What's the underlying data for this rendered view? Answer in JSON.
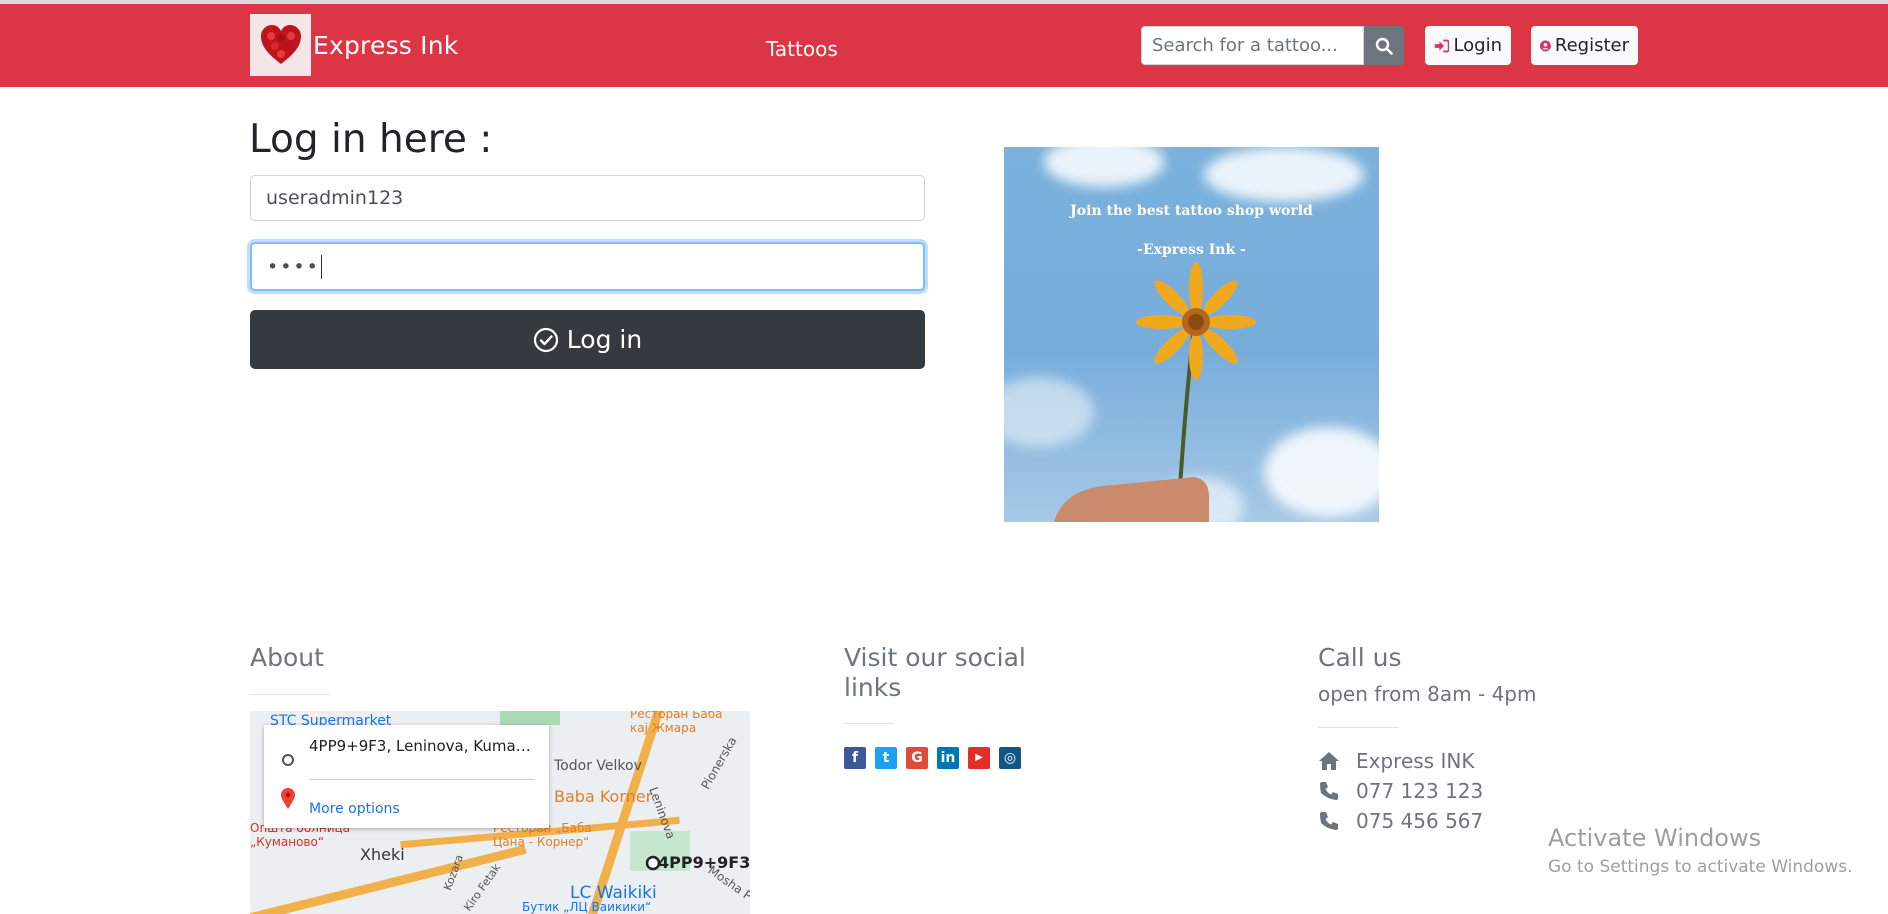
{
  "navbar": {
    "brand": "Express Ink",
    "links": [
      {
        "label": "Tattoos"
      }
    ],
    "search": {
      "placeholder": "Search for a tattoo..."
    },
    "login_label": "Login",
    "register_label": "Register",
    "color": "#dc3545"
  },
  "login_form": {
    "title": "Log in here :",
    "username_value": "useradmin123",
    "password_masked": "••••",
    "submit_label": "Log in"
  },
  "promo": {
    "line1": "Join the best tattoo shop world",
    "line2": "-Express Ink -"
  },
  "footer": {
    "about": {
      "title": "About",
      "map": {
        "address": "4PP9+9F3, Leninova, Kumano...",
        "more_options": "More options",
        "labels": [
          "STC Supermarket",
          "Ресторан Бабa кај Жмара",
          "Todor Velkov",
          "Baba Korner",
          "Ресторан „Баба Цана - Корнер“",
          "Leninova",
          "Pionerska",
          "Општа болница „Куманово“",
          "Xheki",
          "Kozara",
          "Kiro Fetak",
          "4PP9+9F3",
          "LC Waikiki",
          "Бутик „ЛЦ Ваикики“",
          "Mosha P"
        ]
      }
    },
    "social": {
      "title": "Visit our social links",
      "icons": [
        "facebook-icon",
        "twitter-icon",
        "google-icon",
        "linkedin-icon",
        "youtube-icon",
        "instagram-icon"
      ]
    },
    "call": {
      "title": "Call us",
      "subtitle": "open from 8am - 4pm",
      "name": "Express INK",
      "phone1": "077 123 123",
      "phone2": "075 456 567"
    }
  },
  "os_watermark": {
    "title": "Activate Windows",
    "subtitle": "Go to Settings to activate Windows."
  }
}
